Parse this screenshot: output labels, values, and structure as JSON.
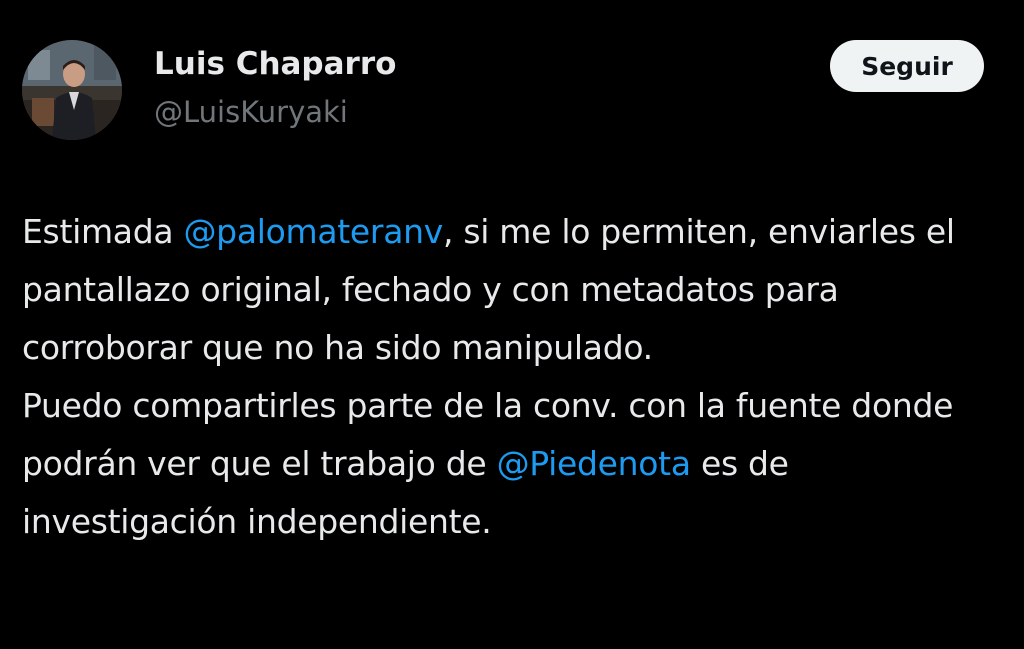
{
  "author": {
    "name": "Luis Chaparro",
    "handle": "@LuisKuryaki",
    "avatar_icon": "user-photo-avatar"
  },
  "follow_button": {
    "label": "Seguir"
  },
  "tweet": {
    "paragraph_1": {
      "part_1": "Estimada ",
      "mention_1": "@palomateranv",
      "part_2": ", si me lo permiten, enviarles el pantallazo original, fechado y con metadatos para corroborar que no ha sido manipulado."
    },
    "paragraph_2": {
      "part_1": "Puedo compartirles parte de la conv. con la fuente donde podrán ver que el trabajo de ",
      "mention_1": "@Piedenota",
      "part_2": " es de investigación independiente."
    }
  },
  "colors": {
    "background": "#000000",
    "text": "#e7e9ea",
    "secondary_text": "#71767b",
    "mention": "#1d9bf0",
    "button_bg": "#eff3f4",
    "button_text": "#0f1419"
  }
}
